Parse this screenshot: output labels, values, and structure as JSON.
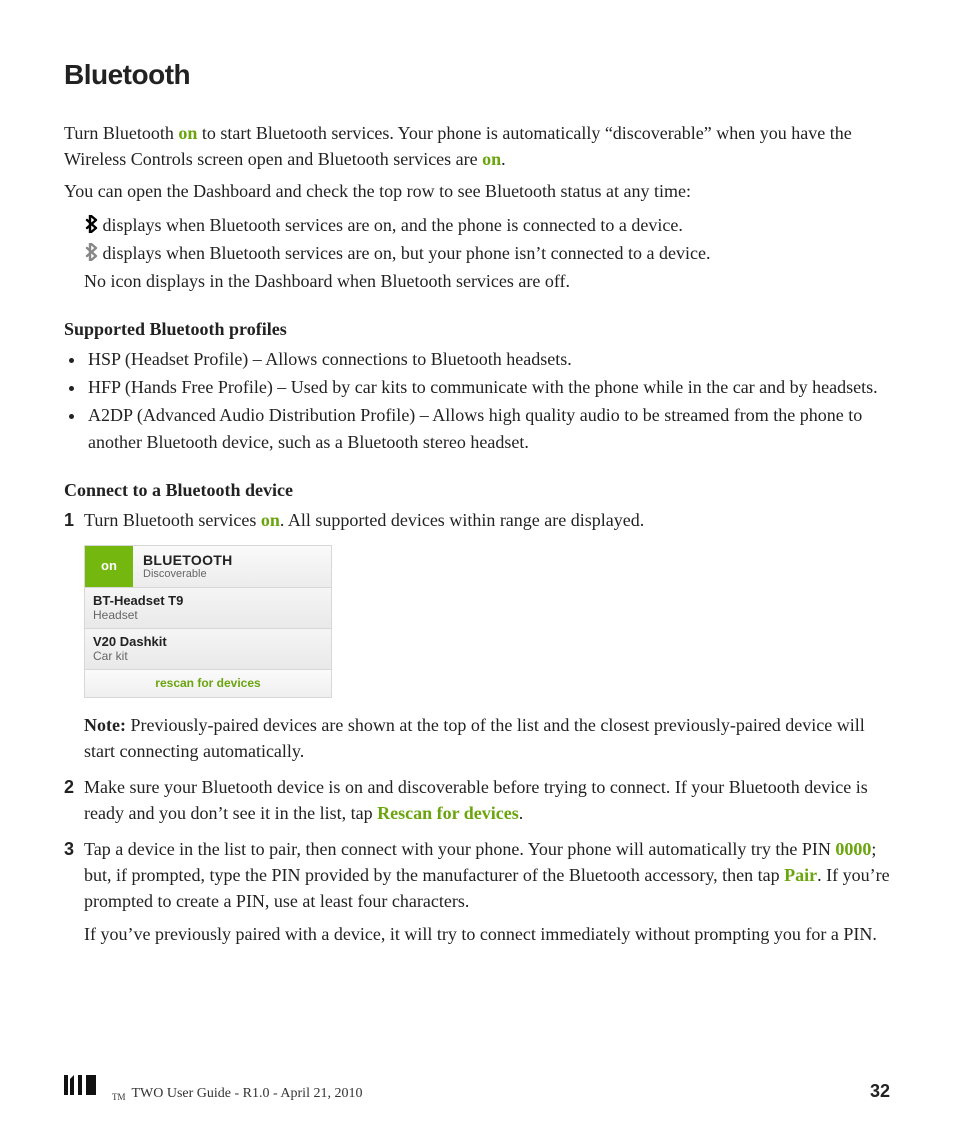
{
  "title": "Bluetooth",
  "intro": {
    "p1_a": "Turn Bluetooth ",
    "p1_on": "on",
    "p1_b": " to start Bluetooth services. Your phone is automatically “discoverable” when you have the Wireless Controls screen open and Bluetooth services are ",
    "p1_on2": "on",
    "p1_c": ".",
    "p2": "You can open the Dashboard and check the top row to see Bluetooth status at any time:"
  },
  "status": {
    "line1": "displays when Bluetooth services are on, and the phone is connected to a device.",
    "line2": "displays when Bluetooth services are on, but your phone isn’t connected to a device.",
    "line3": "No icon displays in the Dashboard when Bluetooth services are off."
  },
  "profiles_head": "Supported Bluetooth profiles",
  "profiles": [
    "HSP (Headset Profile) – Allows connections to Bluetooth headsets.",
    "HFP (Hands Free Profile) – Used by car kits to communicate with the phone while in the car and by headsets.",
    "A2DP (Advanced Audio Distribution Profile) – Allows high quality audio to be streamed from the phone to another Bluetooth device, such as a Bluetooth stereo headset."
  ],
  "connect_head": "Connect to a Bluetooth device",
  "steps": {
    "s1_num": "1",
    "s1_a": "Turn Bluetooth services ",
    "s1_on": "on",
    "s1_b": ". All supported devices within range are displayed.",
    "panel": {
      "on_label": "on",
      "title": "BLUETOOTH",
      "subtitle": "Discoverable",
      "rows": [
        {
          "name": "BT-Headset T9",
          "type": "Headset"
        },
        {
          "name": "V20 Dashkit",
          "type": "Car kit"
        }
      ],
      "rescan": "rescan for devices"
    },
    "s1_note_lead": "Note:",
    "s1_note": " Previously-paired devices are shown at the top of the list and the closest previously-paired device will start connecting automatically.",
    "s2_num": "2",
    "s2_a": "Make sure your Bluetooth device is on and discoverable before trying to connect. If your Bluetooth device is ready and you don’t see it in the list, tap ",
    "s2_rescan": "Rescan for devices",
    "s2_b": ".",
    "s3_num": "3",
    "s3_a": "Tap a device in the list to pair, then connect with your phone. Your phone will automatically try the PIN ",
    "s3_pin": "0000",
    "s3_b": "; but, if prompted, type the PIN provided by the manufacturer of the Bluetooth accessory, then tap ",
    "s3_pair": "Pair",
    "s3_c": ". If you’re prompted to create a PIN, use at least four characters.",
    "s3_p2": "If you’ve previously paired with a device, it will try to connect immediately without prompting you for a PIN."
  },
  "footer": {
    "logo": "KIN",
    "tm": "TM",
    "text": "TWO User Guide - R1.0 - April 21, 2010",
    "page": "32"
  }
}
